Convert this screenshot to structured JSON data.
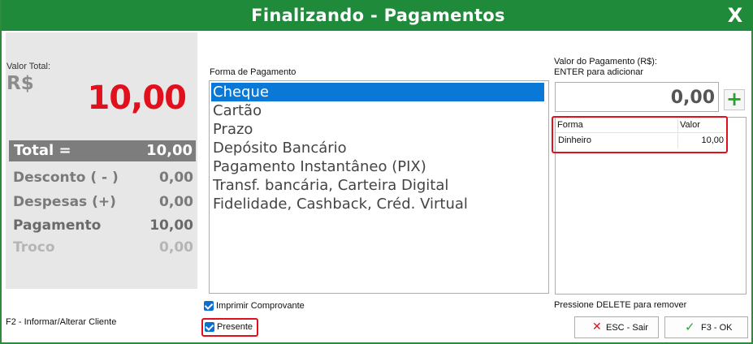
{
  "window": {
    "title": "Finalizando - Pagamentos",
    "close_label": "X"
  },
  "summary": {
    "valor_total_label": "Valor Total:",
    "currency": "R$",
    "big_total": "10,00",
    "total": {
      "label": "Total =",
      "value": "10,00"
    },
    "rows": [
      {
        "label": "Desconto ( - )",
        "value": "0,00"
      },
      {
        "label": "Despesas (+)",
        "value": "0,00"
      },
      {
        "label": "Pagamento",
        "value": "10,00"
      },
      {
        "label": "Troco",
        "value": "0,00"
      }
    ]
  },
  "payment_methods": {
    "label": "Forma de Pagamento",
    "selected_index": 0,
    "items": [
      "Cheque",
      "Cartão",
      "Prazo",
      "Depósito Bancário",
      "Pagamento Instantâneo (PIX)",
      "Transf. bancária, Carteira Digital",
      "Fidelidade, Cashback, Créd. Virtual"
    ]
  },
  "payment_value": {
    "label_line1": "Valor do Pagamento (R$):",
    "label_line2": "ENTER para adicionar",
    "amount": "0,00",
    "add_symbol": "+"
  },
  "payments_grid": {
    "columns": [
      "Forma",
      "Valor"
    ],
    "rows": [
      {
        "forma": "Dinheiro",
        "valor": "10,00"
      }
    ]
  },
  "options": {
    "imprimir_comprovante": {
      "label": "Imprimir Comprovante",
      "checked": true
    },
    "presente": {
      "label": "Presente",
      "checked": true
    }
  },
  "hints": {
    "f2": "F2 - Informar/Alterar Cliente",
    "delete": "Pressione DELETE para remover"
  },
  "buttons": {
    "esc": {
      "icon": "✕",
      "label": "ESC - Sair"
    },
    "ok": {
      "icon": "✓",
      "label": "F3 - OK"
    }
  },
  "colors": {
    "titlebar": "#1f8a3a",
    "accent_red": "#e1101c",
    "selection": "#0a78d7"
  }
}
